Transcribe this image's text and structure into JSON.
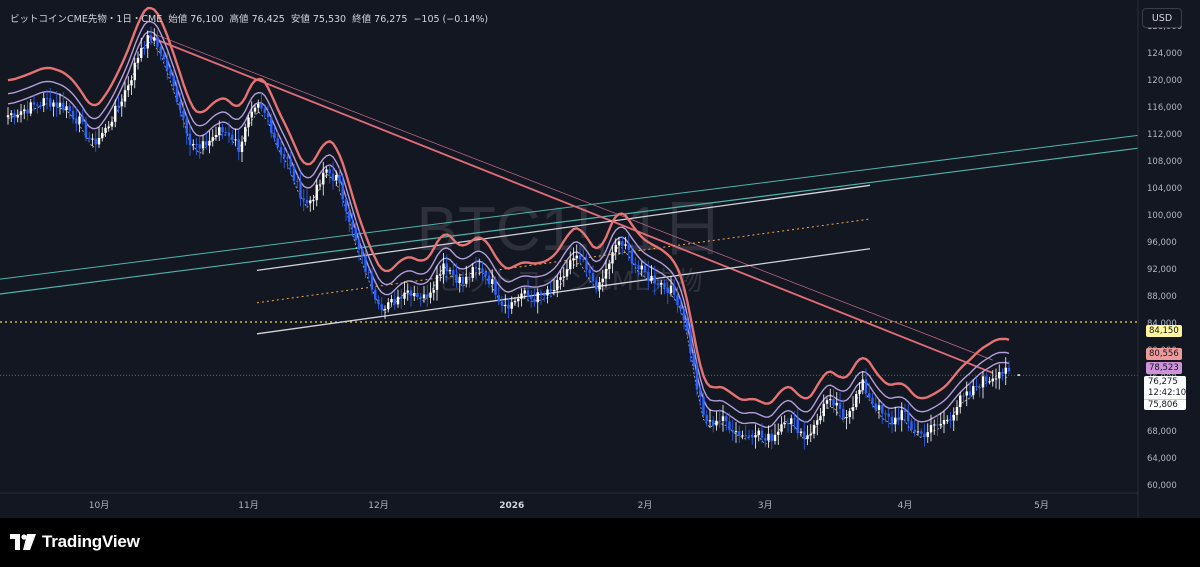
{
  "header": {
    "symbol": "ビットコインCME先物・1日・CME",
    "open_label": "始値",
    "open": "76,100",
    "high_label": "高値",
    "high": "76,425",
    "low_label": "安値",
    "low": "75,530",
    "close_label": "終値",
    "close": "76,275",
    "change": "−105 (−0.14%)"
  },
  "currency_button": "USD",
  "watermark": {
    "line1": "BTC1!, 1日",
    "line2": "ビットコインCME先物"
  },
  "footer": {
    "brand": "TradingView"
  },
  "price_labels": {
    "line_84150": "84,150",
    "band_upper": "80,556",
    "band_mid": "78,523",
    "last_price": "76,275",
    "countdown": "12:42:10",
    "band_lower": "75,806"
  },
  "colors": {
    "background": "#131722",
    "up_candle": "#ffffff",
    "down_candle": "#2962ff",
    "band_upper": "#e57373",
    "band_mid": "#b39ddb",
    "trend_red": "#e06c75",
    "channel_white": "#d1d4dc",
    "teal": "#4db6ac",
    "dotted_yellow": "#f5d142"
  },
  "chart_data": {
    "type": "candlestick",
    "symbol": "BTC1!",
    "timeframe": "1日",
    "currency": "USD",
    "ylim": [
      58500,
      132000
    ],
    "y_ticks": [
      "60,000",
      "64,000",
      "68,000",
      "72,000",
      "76,000",
      "80,000",
      "84,000",
      "88,000",
      "92,000",
      "96,000",
      "100,000",
      "104,000",
      "108,000",
      "112,000",
      "116,000",
      "120,000",
      "124,000",
      "128,000"
    ],
    "x_labels": [
      "10月",
      "11月",
      "12月",
      "2026",
      "2月",
      "3月",
      "4月",
      "5月"
    ],
    "ohlc_last": {
      "open": 76100,
      "high": 76425,
      "low": 75530,
      "close": 76275
    },
    "path_close": [
      [
        0,
        114800
      ],
      [
        6,
        115800
      ],
      [
        12,
        117000
      ],
      [
        18,
        116000
      ],
      [
        22,
        113800
      ],
      [
        26,
        110500
      ],
      [
        30,
        112600
      ],
      [
        34,
        116200
      ],
      [
        38,
        120600
      ],
      [
        41,
        125000
      ],
      [
        44,
        126300
      ],
      [
        47,
        124300
      ],
      [
        50,
        120200
      ],
      [
        53,
        116000
      ],
      [
        56,
        111200
      ],
      [
        59,
        109600
      ],
      [
        62,
        111100
      ],
      [
        65,
        112400
      ],
      [
        68,
        112300
      ],
      [
        71,
        110000
      ],
      [
        74,
        113800
      ],
      [
        77,
        115800
      ],
      [
        80,
        114400
      ],
      [
        83,
        110300
      ],
      [
        86,
        108000
      ],
      [
        89,
        104200
      ],
      [
        92,
        101600
      ],
      [
        95,
        103600
      ],
      [
        98,
        106600
      ],
      [
        101,
        105400
      ],
      [
        104,
        101400
      ],
      [
        107,
        95900
      ],
      [
        110,
        92000
      ],
      [
        113,
        88300
      ],
      [
        116,
        86000
      ],
      [
        119,
        87400
      ],
      [
        122,
        88900
      ],
      [
        125,
        88700
      ],
      [
        128,
        87700
      ],
      [
        131,
        89800
      ],
      [
        134,
        93000
      ],
      [
        137,
        91300
      ],
      [
        140,
        89900
      ],
      [
        143,
        91500
      ],
      [
        146,
        92000
      ],
      [
        149,
        89800
      ],
      [
        152,
        87100
      ],
      [
        155,
        86900
      ],
      [
        158,
        88300
      ],
      [
        161,
        87700
      ],
      [
        164,
        87900
      ],
      [
        167,
        88400
      ],
      [
        170,
        90100
      ],
      [
        173,
        92900
      ],
      [
        176,
        93400
      ],
      [
        179,
        90800
      ],
      [
        182,
        89200
      ],
      [
        185,
        93000
      ],
      [
        188,
        96100
      ],
      [
        191,
        94400
      ],
      [
        194,
        92000
      ],
      [
        197,
        90900
      ],
      [
        200,
        90200
      ],
      [
        203,
        89300
      ],
      [
        206,
        87500
      ],
      [
        208,
        85000
      ],
      [
        210,
        80000
      ],
      [
        212,
        74500
      ],
      [
        214,
        70200
      ],
      [
        216,
        69000
      ],
      [
        218,
        69800
      ],
      [
        221,
        69300
      ],
      [
        224,
        68000
      ],
      [
        227,
        67300
      ],
      [
        230,
        68200
      ],
      [
        233,
        66500
      ],
      [
        236,
        67600
      ],
      [
        239,
        70000
      ],
      [
        242,
        69200
      ],
      [
        245,
        67200
      ],
      [
        248,
        68500
      ],
      [
        251,
        71800
      ],
      [
        254,
        72000
      ],
      [
        257,
        70100
      ],
      [
        260,
        72200
      ],
      [
        263,
        74800
      ],
      [
        266,
        72400
      ],
      [
        269,
        70400
      ],
      [
        272,
        69400
      ],
      [
        275,
        70700
      ],
      [
        278,
        68500
      ],
      [
        281,
        67500
      ],
      [
        284,
        68300
      ],
      [
        287,
        69000
      ],
      [
        290,
        70300
      ],
      [
        293,
        72500
      ],
      [
        296,
        73400
      ],
      [
        299,
        75200
      ],
      [
        302,
        75800
      ],
      [
        305,
        77000
      ],
      [
        308,
        76275
      ]
    ],
    "extra_day_index": 311,
    "overlays": [
      {
        "name": "upper_band",
        "color": "#e57373",
        "offset": 5000
      },
      {
        "name": "mid_band",
        "color": "#b39ddb",
        "offset": 3000
      },
      {
        "name": "lower_band",
        "color": "#b39ddb",
        "offset": 1500
      }
    ],
    "horizontal_lines": [
      {
        "price": 84150,
        "style": "dotted",
        "color": "#f5d142"
      }
    ]
  }
}
